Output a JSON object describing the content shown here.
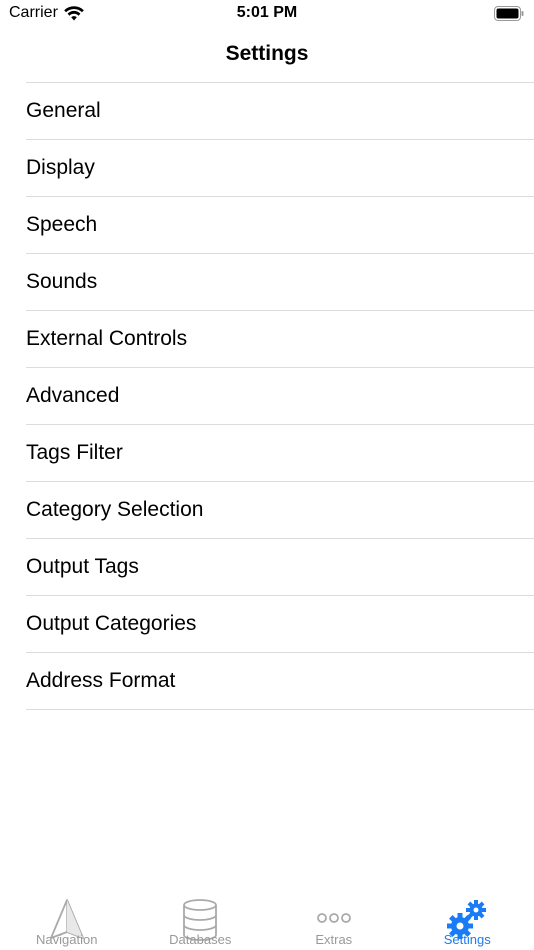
{
  "status_bar": {
    "carrier": "Carrier",
    "time": "5:01 PM"
  },
  "nav": {
    "title": "Settings"
  },
  "settings_items": [
    "General",
    "Display",
    "Speech",
    "Sounds",
    "External Controls",
    "Advanced",
    "Tags Filter",
    "Category Selection",
    "Output Tags",
    "Output Categories",
    "Address Format"
  ],
  "tab_bar": {
    "tabs": [
      {
        "label": "Navigation",
        "icon": "navigation-icon",
        "active": false
      },
      {
        "label": "Databases",
        "icon": "database-icon",
        "active": false
      },
      {
        "label": "Extras",
        "icon": "ellipsis-icon",
        "active": false
      },
      {
        "label": "Settings",
        "icon": "gears-icon",
        "active": true
      }
    ],
    "active_color": "#1a7cf5",
    "inactive_color": "#999999"
  }
}
